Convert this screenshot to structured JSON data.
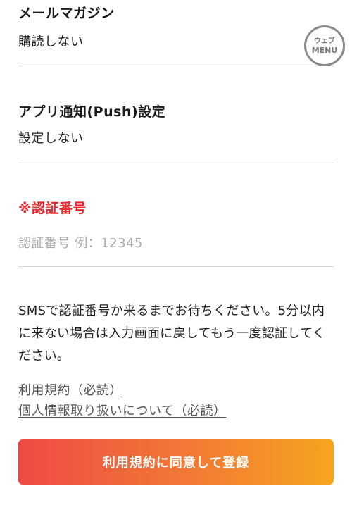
{
  "mail_magazine": {
    "label": "メールマガジン",
    "value": "購読しない"
  },
  "push_settings": {
    "label": "アプリ通知(Push)設定",
    "value": "設定しない"
  },
  "auth_code": {
    "required_mark": "※",
    "label": "認証番号",
    "placeholder": "認証番号 例：12345"
  },
  "notice": "SMSで認証番号か来るまでお待ちください。5分以内に来ない場合は入力画面に戻してもう一度認証してください。",
  "links": {
    "terms": "利用規約（必読）",
    "privacy": "個人情報取り扱いについて（必読）"
  },
  "submit_button": "利用規約に同意して登録",
  "web_menu": {
    "line1": "ウェブ",
    "line2": "MENU"
  }
}
